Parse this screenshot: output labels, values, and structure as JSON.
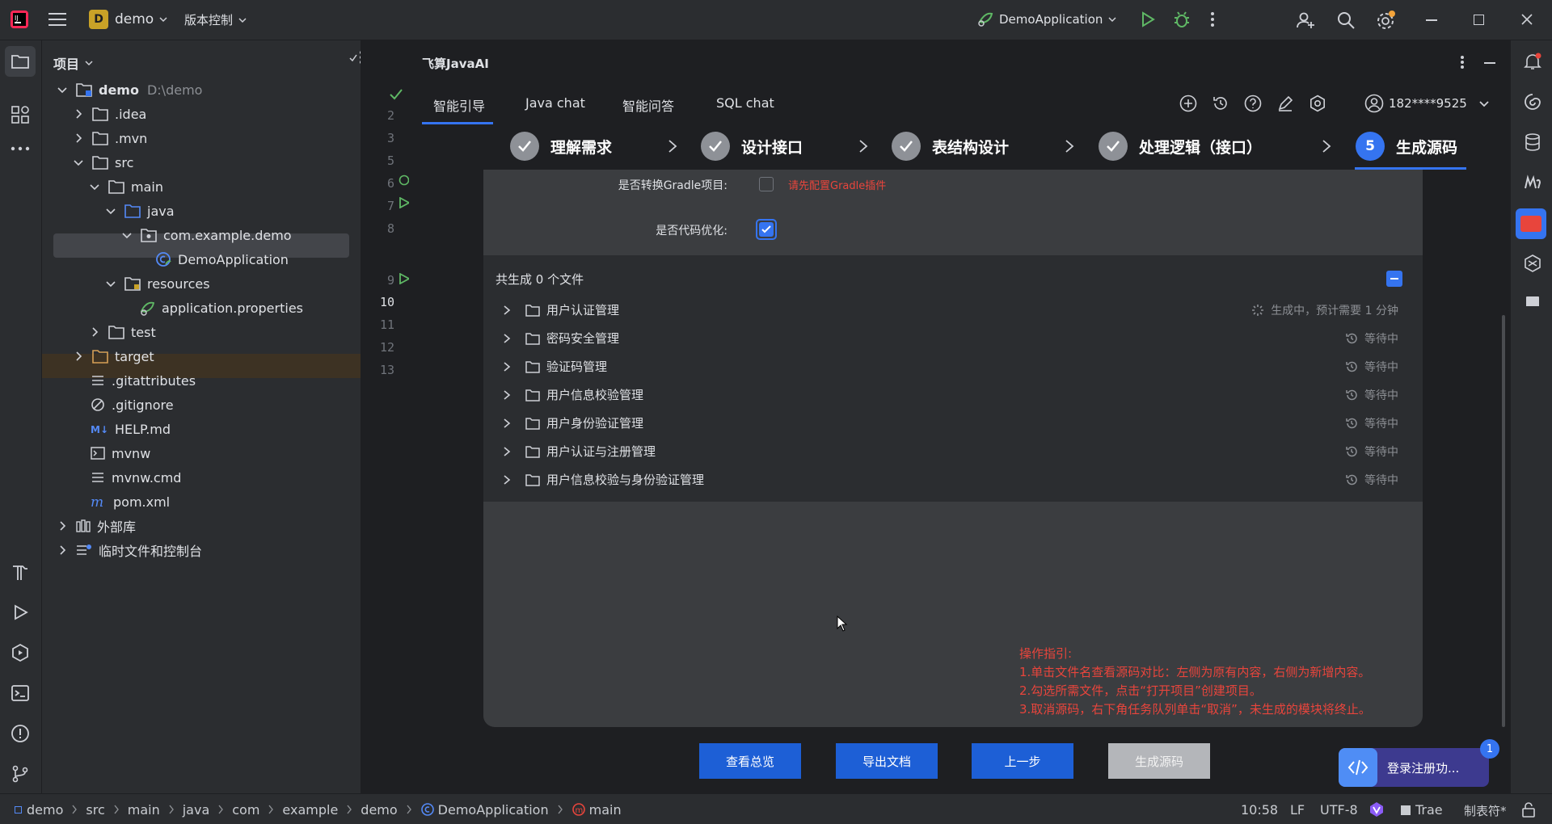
{
  "titlebar": {
    "project_badge": "D",
    "project_name": "demo",
    "vcs_menu": "版本控制",
    "run_config": "DemoApplication"
  },
  "project_panel": {
    "title": "项目",
    "root_name": "demo",
    "root_path": "D:\\demo",
    "items": [
      {
        "label": "demo",
        "path": "D:\\demo"
      },
      {
        "label": ".idea"
      },
      {
        "label": ".mvn"
      },
      {
        "label": "src"
      },
      {
        "label": "main"
      },
      {
        "label": "java"
      },
      {
        "label": "com.example.demo"
      },
      {
        "label": "DemoApplication"
      },
      {
        "label": "resources"
      },
      {
        "label": "application.properties"
      },
      {
        "label": "test"
      },
      {
        "label": "target"
      },
      {
        "label": ".gitattributes"
      },
      {
        "label": ".gitignore"
      },
      {
        "label": "HELP.md"
      },
      {
        "label": "mvnw"
      },
      {
        "label": "mvnw.cmd"
      },
      {
        "label": "pom.xml"
      },
      {
        "label": "外部库"
      },
      {
        "label": "临时文件和控制台"
      }
    ]
  },
  "gutter": {
    "lines": [
      "2",
      "3",
      "5",
      "6",
      "7",
      "8",
      "9",
      "10",
      "11",
      "12",
      "13"
    ]
  },
  "plugin": {
    "title": "飞算JavaAI",
    "tabs": [
      "智能引导",
      "Java chat",
      "智能问答",
      "SQL chat"
    ],
    "user": "182****9525",
    "steps": [
      {
        "label": "理解需求"
      },
      {
        "label": "设计接口"
      },
      {
        "label": "表结构设计"
      },
      {
        "label": "处理逻辑（接口）"
      },
      {
        "label": "生成源码",
        "number": "5"
      }
    ],
    "gradle_label": "是否转换Gradle项目:",
    "gradle_hint": "请先配置Gradle插件",
    "optimize_label": "是否代码优化:",
    "summary": "共生成 0 个文件",
    "modules": [
      {
        "name": "用户认证管理",
        "status": "生成中，预计需要 1 分钟"
      },
      {
        "name": "密码安全管理",
        "status": "等待中"
      },
      {
        "name": "验证码管理",
        "status": "等待中"
      },
      {
        "name": "用户信息校验管理",
        "status": "等待中"
      },
      {
        "name": "用户身份验证管理",
        "status": "等待中"
      },
      {
        "name": "用户认证与注册管理",
        "status": "等待中"
      },
      {
        "name": "用户信息校验与身份验证管理",
        "status": "等待中"
      }
    ],
    "guide": {
      "title": "操作指引:",
      "lines": [
        "1.单击文件名查看源码对比：左侧为原有内容，右侧为新增内容。",
        "2.勾选所需文件，点击“打开项目”创建项目。",
        "3.取消源码，右下角任务队列单击“取消”，未生成的模块将终止。"
      ]
    },
    "buttons": [
      "查看总览",
      "导出文档",
      "上一步",
      "生成源码"
    ],
    "float_badge": "1",
    "float_text": "登录注册功..."
  },
  "statusbar": {
    "breadcrumb": [
      "demo",
      "src",
      "main",
      "java",
      "com",
      "example",
      "demo",
      "DemoApplication",
      "main"
    ],
    "cursor": "10:58",
    "line_sep": "LF",
    "encoding": "UTF-8",
    "trae": "Trae",
    "indent": "制表符*"
  },
  "colors": {
    "accent": "#3574f0",
    "button_blue": "#1d5fd6",
    "warn_red": "#e8453c"
  }
}
